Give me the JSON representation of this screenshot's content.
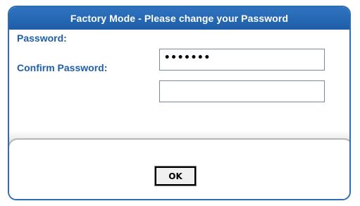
{
  "dialog": {
    "title": "Factory Mode - Please change your Password"
  },
  "form": {
    "password_label": "Password:",
    "password_value": "•••••••",
    "confirm_label": "Confirm Password:",
    "confirm_value": ""
  },
  "actions": {
    "ok_label": "OK"
  },
  "colors": {
    "title_bar": "#1e5ea8",
    "label_text": "#1f5ea8",
    "border": "#2f6db0"
  }
}
